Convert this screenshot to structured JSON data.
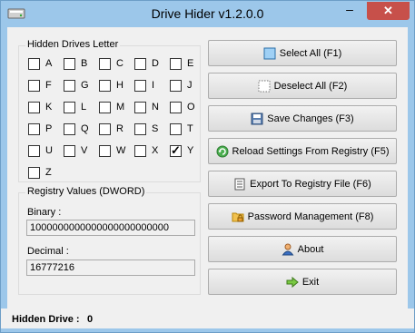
{
  "window": {
    "title": "Drive Hider v1.2.0.0",
    "minimize_glyph": "‒",
    "close_glyph": "✕"
  },
  "drives_group": {
    "title": "Hidden Drives Letter",
    "letters": [
      "A",
      "B",
      "C",
      "D",
      "E",
      "F",
      "G",
      "H",
      "I",
      "J",
      "K",
      "L",
      "M",
      "N",
      "O",
      "P",
      "Q",
      "R",
      "S",
      "T",
      "U",
      "V",
      "W",
      "X",
      "Y",
      "Z"
    ],
    "checked": [
      "Y"
    ]
  },
  "registry_group": {
    "title": "Registry Values (DWORD)",
    "binary_label": "Binary :",
    "binary_value": "1000000000000000000000000",
    "decimal_label": "Decimal :",
    "decimal_value": "16777216"
  },
  "buttons": {
    "select_all": "Select All (F1)",
    "deselect_all": "Deselect All (F2)",
    "save_changes": "Save Changes (F3)",
    "reload": "Reload Settings From Registry (F5)",
    "export": "Export To Registry File (F6)",
    "password": "Password Management (F8)",
    "about": "About",
    "exit": "Exit"
  },
  "icons": {
    "select_all": "select-all-icon",
    "deselect_all": "deselect-all-icon",
    "save_changes": "save-icon",
    "reload": "reload-icon",
    "export": "export-icon",
    "password": "password-folder-icon",
    "about": "about-user-icon",
    "exit": "exit-arrow-icon"
  },
  "status": {
    "label": "Hidden Drive :",
    "value": "0"
  },
  "colors": {
    "frame": "#9cc7ea",
    "close": "#c7504a",
    "client": "#f0f0f0"
  }
}
